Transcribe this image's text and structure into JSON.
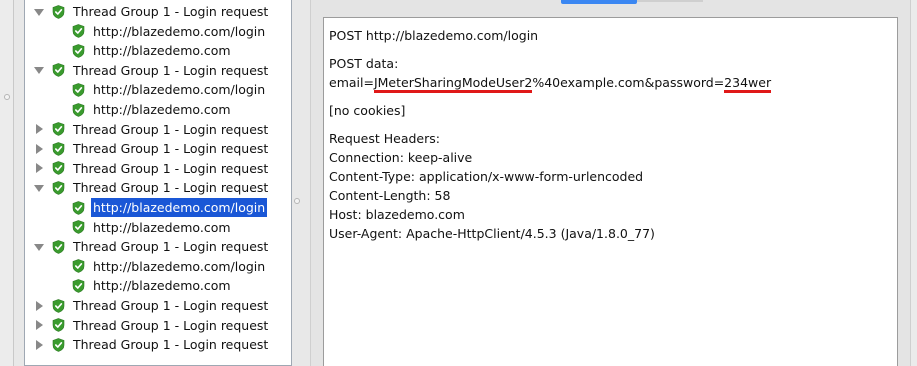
{
  "tree": {
    "items": [
      {
        "label": "Thread Group 1 - Login request",
        "level": 0,
        "expanded": true
      },
      {
        "label": "http://blazedemo.com/login",
        "level": 1
      },
      {
        "label": "http://blazedemo.com",
        "level": 1
      },
      {
        "label": "Thread Group 1 - Login request",
        "level": 0,
        "expanded": true
      },
      {
        "label": "http://blazedemo.com/login",
        "level": 1
      },
      {
        "label": "http://blazedemo.com",
        "level": 1
      },
      {
        "label": "Thread Group 1 - Login request",
        "level": 0,
        "expanded": false
      },
      {
        "label": "Thread Group 1 - Login request",
        "level": 0,
        "expanded": false
      },
      {
        "label": "Thread Group 1 - Login request",
        "level": 0,
        "expanded": false
      },
      {
        "label": "Thread Group 1 - Login request",
        "level": 0,
        "expanded": true
      },
      {
        "label": "http://blazedemo.com/login",
        "level": 1,
        "selected": true
      },
      {
        "label": "http://blazedemo.com",
        "level": 1
      },
      {
        "label": "Thread Group 1 - Login request",
        "level": 0,
        "expanded": true
      },
      {
        "label": "http://blazedemo.com/login",
        "level": 1
      },
      {
        "label": "http://blazedemo.com",
        "level": 1
      },
      {
        "label": "Thread Group 1 - Login request",
        "level": 0,
        "expanded": false
      },
      {
        "label": "Thread Group 1 - Login request",
        "level": 0,
        "expanded": false
      },
      {
        "label": "Thread Group 1 - Login request",
        "level": 0,
        "expanded": false
      }
    ]
  },
  "request": {
    "line1": "POST http://blazedemo.com/login",
    "post_data_label": "POST data:",
    "email_prefix": "email=",
    "email_user": "JMeterSharingModeUser2",
    "email_rest": "%40example.com&password=",
    "password": "234wer",
    "cookies": "[no cookies]",
    "headers_label": "Request Headers:",
    "headers": [
      "Connection: keep-alive",
      "Content-Type: application/x-www-form-urlencoded",
      "Content-Length: 58",
      "Host: blazedemo.com",
      "User-Agent: Apache-HttpClient/4.5.3 (Java/1.8.0_77)"
    ]
  },
  "colors": {
    "selection": "#1a57d6",
    "underline": "#e01818",
    "shield_green": "#3a9b2e",
    "tab_accent": "#3b87f2"
  }
}
